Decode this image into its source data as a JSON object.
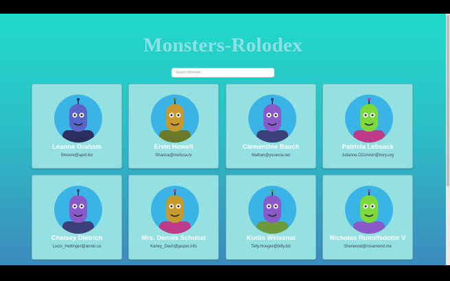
{
  "page": {
    "title": "Monsters-Rolodex"
  },
  "search": {
    "placeholder": "Seach Monster"
  },
  "monsters": [
    {
      "name": "Leanne Graham",
      "email": "Sincere@april.biz",
      "body_color": "#5a63c6",
      "accent": "#2b2f5e"
    },
    {
      "name": "Ervin Howell",
      "email": "Shanna@melissa.tv",
      "body_color": "#c69a2c",
      "accent": "#6a7a2a"
    },
    {
      "name": "Clementine Bauch",
      "email": "Nathan@yesenia.net",
      "body_color": "#8a5ac8",
      "accent": "#3b3f7a"
    },
    {
      "name": "Patricia Lebsack",
      "email": "Julianne.OConner@kory.org",
      "body_color": "#7dd83a",
      "accent": "#c03a8a"
    },
    {
      "name": "Chelsey Dietrich",
      "email": "Lucio_Hettinger@annie.ca",
      "body_color": "#8a5ac8",
      "accent": "#3b3f7a"
    },
    {
      "name": "Mrs. Dennis Schulist",
      "email": "Karley_Dach@jasper.info",
      "body_color": "#c69a2c",
      "accent": "#c03a8a"
    },
    {
      "name": "Kurtis Weissnat",
      "email": "Telly.Hoeger@billy.biz",
      "body_color": "#8a5ac8",
      "accent": "#6a9a3a"
    },
    {
      "name": "Nicholas Runolfsdottir V",
      "email": "Sherwood@rosamond.me",
      "body_color": "#7dd83a",
      "accent": "#8a5ac8"
    }
  ]
}
